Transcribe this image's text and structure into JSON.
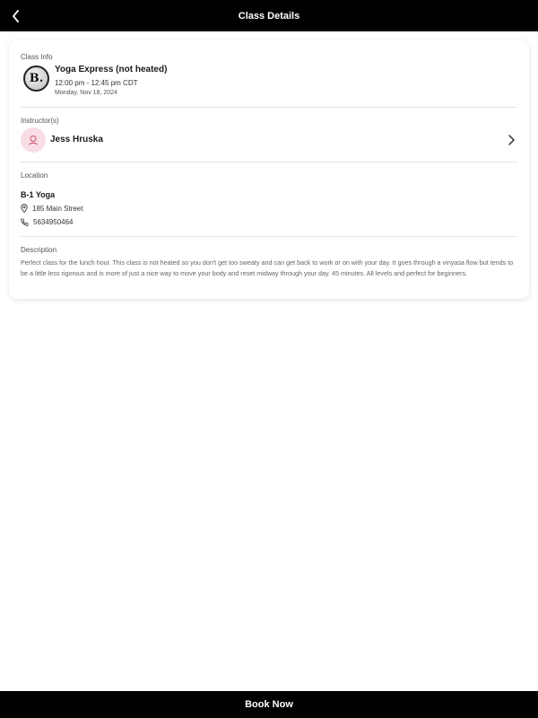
{
  "header": {
    "title": "Class Details",
    "back_icon": "chevron-left-icon"
  },
  "class_info": {
    "label": "Class Info",
    "logo_letter": "B.",
    "name": "Yoga Express (not heated)",
    "time": "12:00 pm - 12:45 pm CDT",
    "date": "Monday, Nov 18, 2024"
  },
  "instructor": {
    "label": "Instructor(s)",
    "name": "Jess Hruska",
    "avatar_icon": "person-icon",
    "avatar_color": "#f8dde4"
  },
  "location": {
    "label": "Location",
    "name": "B-1 Yoga",
    "address": "185 Main Street",
    "phone": "5634950464"
  },
  "description": {
    "label": "Description",
    "text": "Perfect class for the lunch hour.  This class is not heated so you don't get too sweaty and can get back to work or on with your day.  It goes through a vinyasa flow but tends to be a little less rigorous and is more of just a nice way to move your body and reset midway through your day.  45 minutes.  All levels and perfect for beginners."
  },
  "footer": {
    "book_label": "Book Now"
  }
}
